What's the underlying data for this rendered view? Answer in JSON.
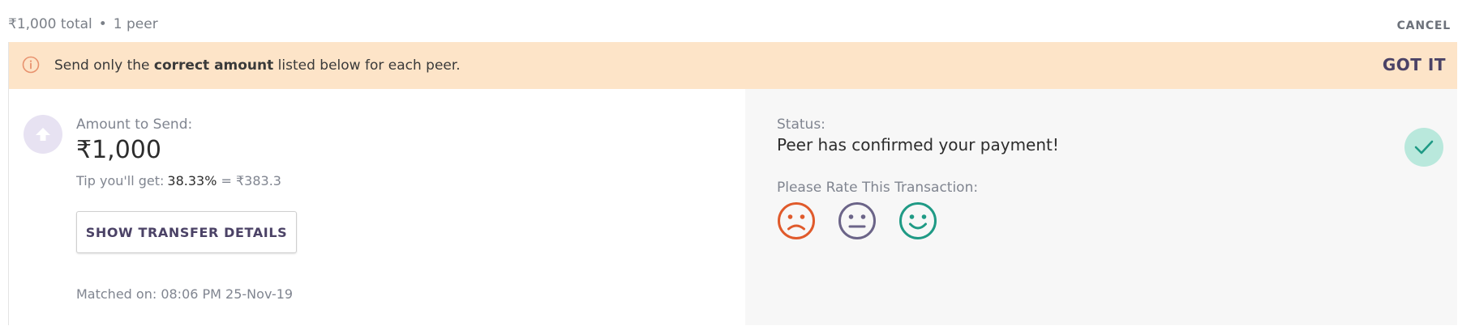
{
  "summary": {
    "total": "₹1,000 total",
    "separator": "•",
    "peers": "1 peer"
  },
  "header": {
    "cancel_label": "CANCEL"
  },
  "alert": {
    "prefix": "Send only the ",
    "emphasis": "correct amount",
    "suffix": " listed below for each peer.",
    "action_label": "GOT IT",
    "icon": "info-icon",
    "background": "#fde4c8"
  },
  "send": {
    "icon": "upload-arrow-icon",
    "amount_label": "Amount to Send:",
    "amount_value": "₹1,000",
    "tip_label": "Tip you'll get:",
    "tip_percent": "38.33%",
    "tip_amount": " = ₹383.3",
    "show_details_label": "SHOW TRANSFER DETAILS",
    "matched_on": "Matched on: 08:06 PM 25-Nov-19"
  },
  "status": {
    "label": "Status:",
    "value": "Peer has confirmed your payment!",
    "icon": "checkmark-icon",
    "rate_label": "Please Rate This Transaction:",
    "ratings": [
      {
        "name": "sad",
        "color": "#e05a2b"
      },
      {
        "name": "neutral",
        "color": "#6b6488"
      },
      {
        "name": "happy",
        "color": "#1f9a85"
      }
    ]
  }
}
